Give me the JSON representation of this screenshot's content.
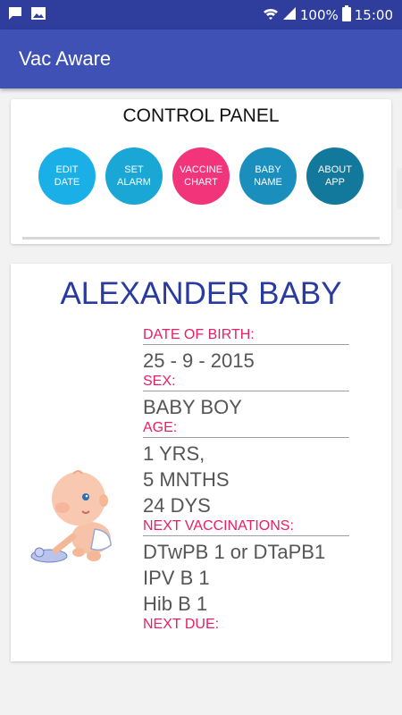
{
  "status": {
    "battery": "100%",
    "time": "15:00"
  },
  "app": {
    "title": "Vac Aware"
  },
  "control_panel": {
    "title": "CONTROL PANEL",
    "buttons": [
      {
        "label": "EDIT\nDATE",
        "color": "#1aafe6"
      },
      {
        "label": "SET\nALARM",
        "color": "#1aa7d6"
      },
      {
        "label": "VACCINE\nCHART",
        "color": "#f2347a"
      },
      {
        "label": "BABY\nNAME",
        "color": "#1a8fbd"
      },
      {
        "label": "ABOUT\nAPP",
        "color": "#13799c"
      }
    ]
  },
  "profile": {
    "name": "ALEXANDER BABY",
    "dob_label": "DATE OF BIRTH:",
    "dob": "25 - 9 - 2015",
    "sex_label": "SEX:",
    "sex": "BABY BOY",
    "age_label": "AGE:",
    "age": "1 YRS,\n5 MNTHS\n24 DYS",
    "next_vacc_label": "NEXT VACCINATIONS:",
    "next_vacc": "DTwPB 1 or DTaPB1\nIPV B 1\nHib B 1",
    "next_due_label": "NEXT DUE:"
  },
  "colors": {
    "primary": "#3f51b5",
    "primary_dark": "#2f3d9c",
    "accent": "#e91e63",
    "name_color": "#2a3b9e"
  }
}
